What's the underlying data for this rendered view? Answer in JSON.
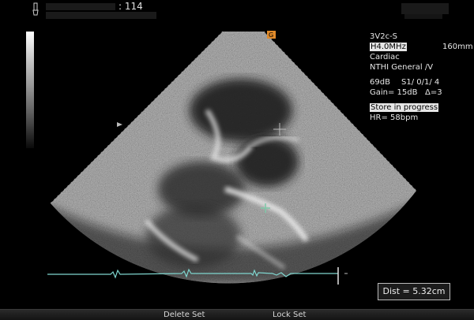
{
  "header": {
    "patient_id": ": 114",
    "probe_icon": "probe-icon"
  },
  "orientation_marker": "G",
  "info_panel": {
    "probe": "3V2c-S",
    "frequency": "H4.0MHz",
    "depth": "160mm",
    "application": "Cardiac",
    "preset": "NTHI General /V",
    "power": "69dB",
    "s_settings": "S1/ 0/1/ 4",
    "gain": "Gain= 15dB",
    "delta": "Δ=3",
    "status": "Store in progress",
    "heart_rate": "HR= 58bpm"
  },
  "measurement": {
    "distance": "Dist = 5.32cm"
  },
  "softkeys": {
    "delete_set": "Delete Set",
    "lock_set": "Lock Set"
  },
  "colors": {
    "background": "#000000",
    "ecg_trace": "#7fd6cf",
    "caliper": "#7fc9a8",
    "orientation_marker": "#e08a2a"
  }
}
